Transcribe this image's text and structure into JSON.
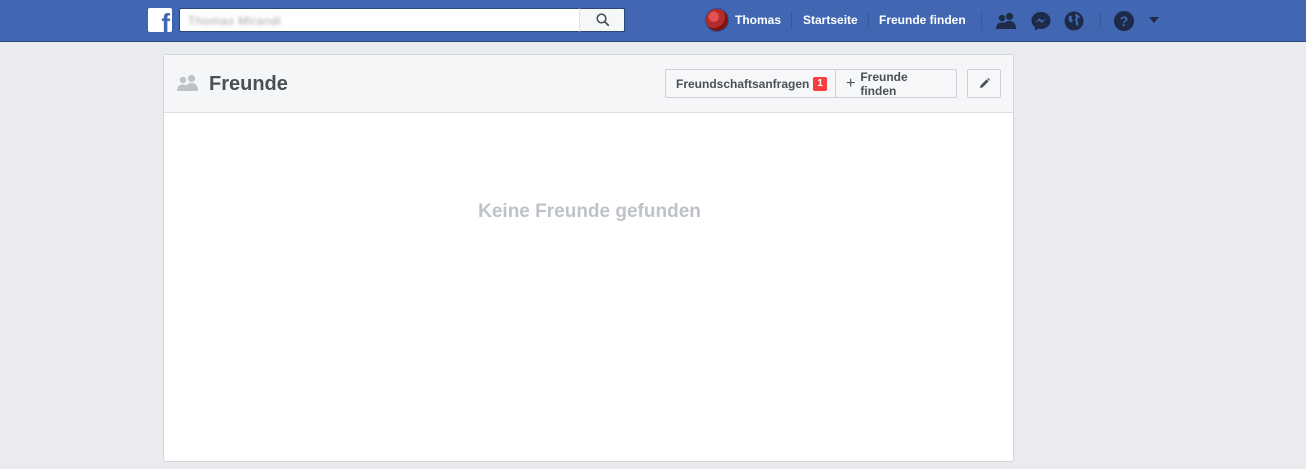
{
  "topbar": {
    "search_value": "Thomas Mirandi",
    "user_name": "Thomas",
    "nav_home": "Startseite",
    "nav_find_friends": "Freunde finden"
  },
  "icons": {
    "logo": "facebook-logo",
    "search": "search-icon",
    "friends": "friends-icon",
    "messenger": "messenger-icon",
    "notifications": "globe-icon",
    "help": "help-icon",
    "menu": "caret-down-icon"
  },
  "colors": {
    "topbar": "#4267b2",
    "badge": "#fa3e3e",
    "empty_text": "#bec2c9"
  },
  "page": {
    "title": "Freunde",
    "requests_label": "Freundschaftsanfragen",
    "requests_count": "1",
    "find_friends_label": "Freunde finden",
    "plus_symbol": "+",
    "empty_message": "Keine Freunde gefunden"
  }
}
